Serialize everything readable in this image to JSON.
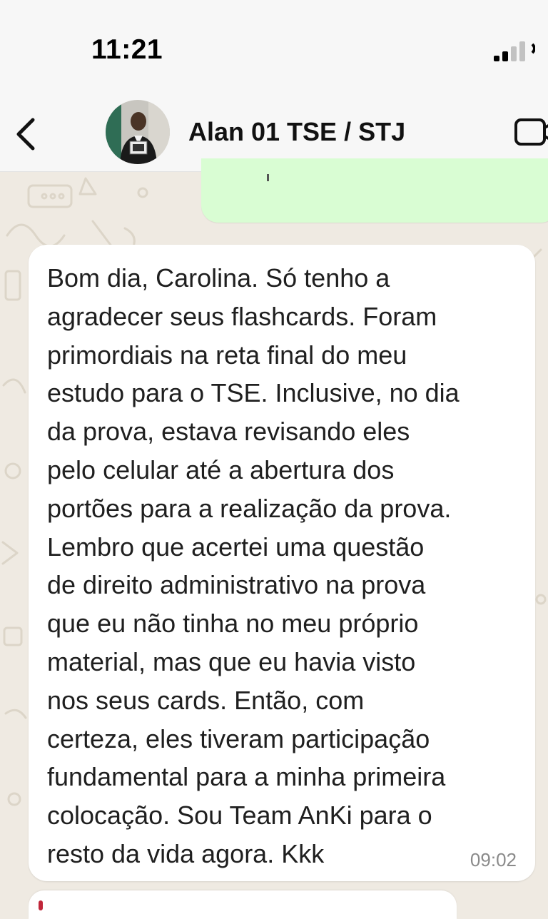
{
  "status_bar": {
    "time": "11:21"
  },
  "header": {
    "contact_name": "Alan 01 TSE / STJ",
    "back_icon": "chevron-left-icon",
    "video_icon": "video-camera-icon"
  },
  "messages": [
    {
      "direction": "incoming",
      "text": "Bom dia, Carolina. Só tenho a\nagradecer seus flashcards. Foram\nprimordiais na reta final do meu\nestudo para o TSE. Inclusive, no dia\nda prova, estava revisando eles\npelo celular até a abertura dos\nportões para a realização da prova.\nLembro que acertei uma questão\nde direito administrativo na prova\nque eu não tinha no meu próprio\nmaterial, mas que eu havia visto\nnos seus cards. Então, com\ncerteza, eles tiveram participação\nfundamental para a minha primeira\ncolocação. Sou Team AnKi para o\nresto da vida agora. Kkk",
      "time": "09:02"
    }
  ],
  "colors": {
    "chat_background": "#efeae2",
    "outgoing_bubble": "#d9fdd3",
    "incoming_bubble": "#ffffff",
    "header_background": "#f7f7f7"
  }
}
